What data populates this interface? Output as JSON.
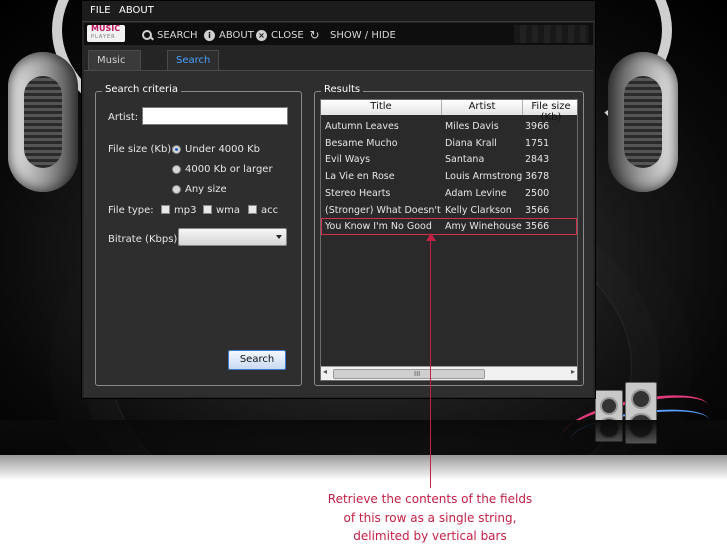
{
  "menu": {
    "items": [
      "FILE",
      "ABOUT"
    ]
  },
  "logo": {
    "line1": "MUSIC",
    "line2": "PLAYER"
  },
  "toolbar": {
    "search": "SEARCH",
    "about": "ABOUT",
    "close": "CLOSE",
    "showhide": "SHOW / HIDE"
  },
  "tabs": [
    {
      "label": "Music Library",
      "active": false
    },
    {
      "label": "Search",
      "active": true
    }
  ],
  "search_criteria": {
    "legend": "Search criteria",
    "artist_label": "Artist:",
    "artist_value": "",
    "file_size_label": "File size (Kb):",
    "file_size_options": [
      "Under 4000 Kb",
      "4000 Kb or larger",
      "Any size"
    ],
    "file_size_selected": "Under 4000 Kb",
    "file_type_label": "File type:",
    "file_types": [
      "mp3",
      "wma",
      "acc"
    ],
    "bitrate_label": "Bitrate (Kbps):",
    "bitrate_value": "",
    "search_button": "Search"
  },
  "results": {
    "legend": "Results",
    "columns": [
      "Title",
      "Artist",
      "File size (Kb)"
    ],
    "rows": [
      [
        "Autumn Leaves",
        "Miles Davis",
        "3966"
      ],
      [
        "Besame Mucho",
        "Diana Krall",
        "1751"
      ],
      [
        "Evil Ways",
        "Santana",
        "2843"
      ],
      [
        "La Vie en Rose",
        "Louis Armstrong",
        "3678"
      ],
      [
        "Stereo Hearts",
        "Adam Levine",
        "2500"
      ],
      [
        "(Stronger) What Doesn't K",
        "Kelly Clarkson",
        "3566"
      ],
      [
        "You Know I'm No Good",
        "Amy Winehouse",
        "3566"
      ]
    ],
    "highlighted_row": 6,
    "scroll_grip": "III"
  },
  "annotation": {
    "lines": [
      "Retrieve the contents of the fields",
      "of this row as a single string,",
      "delimited by vertical bars"
    ],
    "color": "#c42045"
  },
  "colors": {
    "accent": "#4aa3ff",
    "highlight": "#d0314b"
  }
}
